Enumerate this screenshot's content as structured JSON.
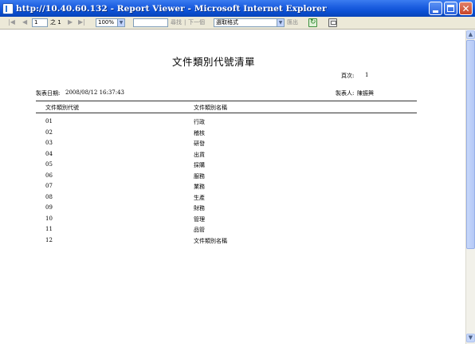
{
  "window": {
    "title": "http://10.40.60.132 - Report Viewer - Microsoft Internet Explorer",
    "buttons": {
      "minimize": "",
      "maximize": "",
      "close": "✕"
    }
  },
  "toolbar": {
    "first_page": "|◀",
    "prev_page": "◀",
    "page_input_value": "1",
    "page_of_label": "之 1",
    "next_page": "▶",
    "last_page": "▶|",
    "zoom_value": "100%",
    "find_input_value": "",
    "find_label": "尋找",
    "separator": "|",
    "find_next_label": "下一個",
    "export_format_value": "選取格式",
    "export_label": "匯出",
    "refresh_icon": "refresh-icon",
    "print_icon": "print-icon"
  },
  "report": {
    "title": "文件類別代號清單",
    "page_label": "頁次:",
    "page_number": "1",
    "date_label": "製表日期:",
    "date_value": "2008/08/12 16:37:43",
    "creator_label": "製表人:",
    "creator_value": "陳振興",
    "columns": {
      "code": "文件類別代號",
      "name": "文件類別名稱"
    },
    "rows": [
      {
        "code": "01",
        "name": "行政"
      },
      {
        "code": "02",
        "name": "稽核"
      },
      {
        "code": "03",
        "name": "研發"
      },
      {
        "code": "04",
        "name": "出貨"
      },
      {
        "code": "05",
        "name": "採購"
      },
      {
        "code": "06",
        "name": "服務"
      },
      {
        "code": "07",
        "name": "業務"
      },
      {
        "code": "08",
        "name": "生產"
      },
      {
        "code": "09",
        "name": "財務"
      },
      {
        "code": "10",
        "name": "管理"
      },
      {
        "code": "11",
        "name": "品管"
      },
      {
        "code": "12",
        "name": "文件類別名稱"
      }
    ]
  },
  "scrollbar": {
    "up_arrow": "▲",
    "down_arrow": "▼"
  }
}
